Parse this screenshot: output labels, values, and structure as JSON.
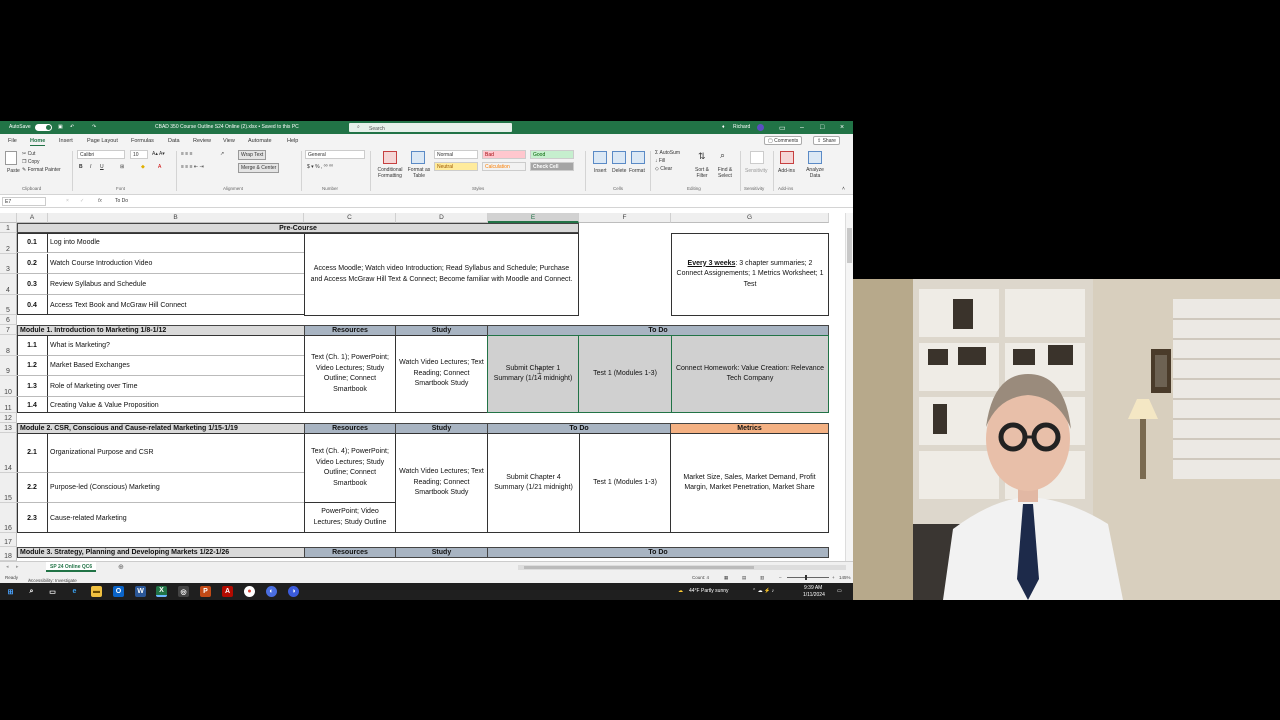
{
  "titlebar": {
    "autosave_label": "AutoSave",
    "autosave_state": "On",
    "file_title": "CBAD 350 Course Outline S24 Online (2).xlsx • Saved to this PC",
    "search_placeholder": "Search",
    "user_name": "Richard"
  },
  "menu": {
    "tabs": [
      "File",
      "Home",
      "Insert",
      "Page Layout",
      "Formulas",
      "Data",
      "Review",
      "View",
      "Automate",
      "Help"
    ],
    "comments_label": "Comments",
    "share_label": "Share"
  },
  "ribbon": {
    "clipboard": {
      "paste": "Paste",
      "cut": "Cut",
      "copy": "Copy",
      "format_painter": "Format Painter",
      "group": "Clipboard"
    },
    "font": {
      "name": "Calibri",
      "size": "10",
      "group": "Font"
    },
    "alignment": {
      "wrap_text": "Wrap Text",
      "merge_center": "Merge & Center",
      "group": "Alignment"
    },
    "number": {
      "format": "General",
      "group": "Number"
    },
    "styles": {
      "conditional": "Conditional Formatting",
      "format_table": "Format as Table",
      "normal": "Normal",
      "bad": "Bad",
      "good": "Good",
      "neutral": "Neutral",
      "calculation": "Calculation",
      "check_cell": "Check Cell",
      "group": "Styles"
    },
    "cells": {
      "insert": "Insert",
      "delete": "Delete",
      "format": "Format",
      "group": "Cells"
    },
    "editing": {
      "autosum": "AutoSum",
      "fill": "Fill",
      "clear": "Clear",
      "sort_filter": "Sort & Filter",
      "find_select": "Find & Select",
      "group": "Editing"
    },
    "sensitivity": {
      "label": "Sensitivity",
      "group": "Sensitivity"
    },
    "addins": {
      "label": "Add-ins",
      "analyze": "Analyze Data",
      "group": "Add-ins"
    }
  },
  "formula_bar": {
    "name_box": "E7",
    "fx": "fx",
    "value": "To Do"
  },
  "columns": [
    "A",
    "B",
    "C",
    "D",
    "E",
    "F",
    "G"
  ],
  "rows": [
    "1",
    "2",
    "3",
    "4",
    "5",
    "6",
    "7",
    "8",
    "9",
    "10",
    "11",
    "12",
    "13",
    "14",
    "15",
    "16",
    "17",
    "18"
  ],
  "sheet": {
    "precourse_title": "Pre-Course",
    "precourse_items": [
      {
        "num": "0.1",
        "text": "Log into Moodle"
      },
      {
        "num": "0.2",
        "text": "Watch Course Introduction Video"
      },
      {
        "num": "0.3",
        "text": "Review Syllabus and Schedule"
      },
      {
        "num": "0.4",
        "text": "Access Text Book and McGraw Hill Connect"
      }
    ],
    "precourse_desc": "Access Moodle; Watch video Introduction; Read Syllabus and Schedule; Purchase and Access McGraw Hill Text & Connect; Become familiar with Moodle and Connect.",
    "precourse_note_bold": "Every 3 weeks",
    "precourse_note_rest": ": 3 chapter summaries; 2 Connect Assignements; 1 Metrics Worksheet; 1 Test",
    "module1": {
      "title": "Module 1. Introduction to Marketing 1/8-1/12",
      "resources_hdr": "Resources",
      "study_hdr": "Study",
      "todo_hdr": "To Do",
      "items": [
        {
          "num": "1.1",
          "text": "What is Marketing?"
        },
        {
          "num": "1.2",
          "text": "Market Based Exchanges"
        },
        {
          "num": "1.3",
          "text": "Role of Marketing over Time"
        },
        {
          "num": "1.4",
          "text": "Creating Value & Value Proposition"
        }
      ],
      "resources": "Text (Ch. 1); PowerPoint; Video Lectures; Study Outline; Connect Smartbook",
      "study": "Watch Video Lectures; Text Reading; Connect Smartbook Study",
      "todo1": "Submit Chapter 1 Summary (1/14 midnight)",
      "todo2": "Test 1 (Modules 1-3)",
      "todo3": "Connect Homework: Value Creation: Relevance Tech Company"
    },
    "module2": {
      "title": "Module 2. CSR, Conscious and Cause-related Marketing 1/15-1/19",
      "resources_hdr": "Resources",
      "study_hdr": "Study",
      "todo_hdr": "To Do",
      "metrics_hdr": "Metrics",
      "items": [
        {
          "num": "2.1",
          "text": "Organizational Purpose and CSR"
        },
        {
          "num": "2.2",
          "text": "Purpose-led (Conscious) Marketing"
        },
        {
          "num": "2.3",
          "text": "Cause-related Marketing"
        }
      ],
      "resources1": "Text (Ch. 4); PowerPoint; Video Lectures; Study Outline; Connect Smartbook",
      "resources2": "PowerPoint; Video Lectures; Study Outline",
      "study": "Watch Video Lectures; Text Reading; Connect Smartbook Study",
      "todo1": "Submit Chapter 4 Summary (1/21 midnight)",
      "todo2": "Test 1 (Modules 1-3)",
      "metrics": "Market Size, Sales, Market Demand, Profit Margin, Market Penetration, Market Share"
    },
    "module3": {
      "title": "Module 3. Strategy, Planning and Developing Markets 1/22-1/26",
      "resources_hdr": "Resources",
      "study_hdr": "Study",
      "todo_hdr": "To Do"
    }
  },
  "sheet_tab": "SP 24 Online QC6",
  "status": {
    "ready": "Ready",
    "accessibility": "Accessibility: Investigate",
    "count": "Count: 4",
    "zoom": "145%"
  },
  "taskbar": {
    "weather": "44°F  Partly sunny",
    "time": "9:39 AM",
    "date": "1/11/2024"
  },
  "colors": {
    "excel_green": "#217346",
    "header_grey": "#a8b4c2",
    "metrics_orange": "#f4b183"
  }
}
